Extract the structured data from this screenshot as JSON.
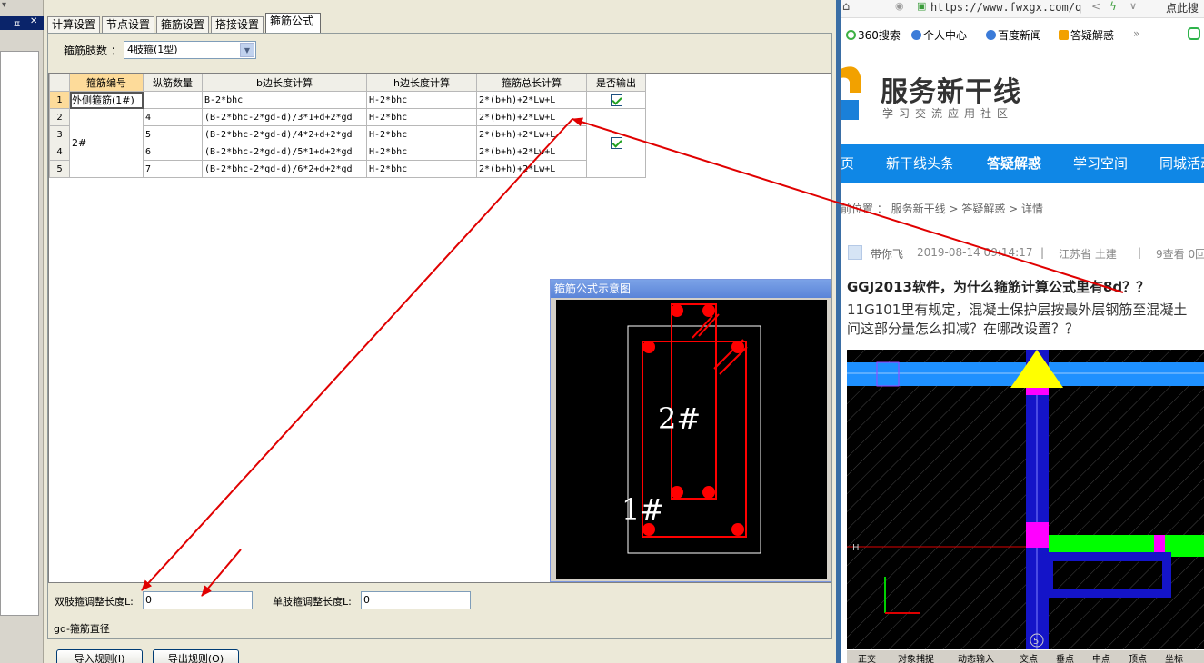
{
  "app": {
    "tabs": [
      "计算设置",
      "节点设置",
      "箍筋设置",
      "搭接设置",
      "箍筋公式"
    ],
    "active_tab": "箍筋公式",
    "limbs_label": "箍筋肢数 ：",
    "limbs_value": "4肢箍(1型)",
    "grid": {
      "headers": [
        "箍筋编号",
        "纵筋数量",
        "b边长度计算",
        "h边长度计算",
        "箍筋总长计算",
        "是否输出"
      ],
      "rows": [
        {
          "num": "1",
          "id": "外侧箍筋(1#)",
          "count": "",
          "b": "B-2*bhc",
          "h": "H-2*bhc",
          "total": "2*(b+h)+2*Lw+L"
        },
        {
          "num": "2",
          "id": "2#",
          "count": "4",
          "b": "(B-2*bhc-2*gd-d)/3*1+d+2*gd",
          "h": "H-2*bhc",
          "total": "2*(b+h)+2*Lw+L"
        },
        {
          "num": "3",
          "id": "",
          "count": "5",
          "b": "(B-2*bhc-2*gd-d)/4*2+d+2*gd",
          "h": "H-2*bhc",
          "total": "2*(b+h)+2*Lw+L"
        },
        {
          "num": "4",
          "id": "",
          "count": "6",
          "b": "(B-2*bhc-2*gd-d)/5*1+d+2*gd",
          "h": "H-2*bhc",
          "total": "2*(b+h)+2*Lw+L"
        },
        {
          "num": "5",
          "id": "",
          "count": "7",
          "b": "(B-2*bhc-2*gd-d)/6*2+d+2*gd",
          "h": "H-2*bhc",
          "total": "2*(b+h)+2*Lw+L"
        }
      ]
    },
    "diagram": {
      "title": "箍筋公式示意图",
      "label_inner": "2#",
      "label_outer": "1#"
    },
    "double_limb_label": "双肢箍调整长度L:",
    "double_limb_value": "0",
    "single_limb_label": "单肢箍调整长度L:",
    "single_limb_value": "0",
    "gd_note": "gd-箍筋直径",
    "import_btn": "导入规则(I)",
    "export_btn": "导出规则(O)",
    "pin_glyph": "ㅍ",
    "close_glyph": "✕"
  },
  "browser": {
    "url": "https://www.fwxgx.com/q",
    "addr_right": "点此搜",
    "bookmarks": [
      "360搜索",
      "个人中心",
      "百度新闻",
      "答疑解惑"
    ],
    "more": "»",
    "logo": "服务新干线",
    "logo_sub": "学习交流应用社区",
    "nav": [
      "页",
      "新干线头条",
      "答疑解惑",
      "学习空间",
      "同城活动"
    ],
    "nav_active": "答疑解惑",
    "breadcrumb": "前位置 ： 服务新干线 > 答疑解惑 > 详情",
    "author": "带你飞",
    "date": "2019-08-14 09:14:17",
    "sep": "|",
    "location": "江苏省  土建",
    "views": "9查看  0回",
    "question_title": "GGJ2013软件，为什么箍筋计算公式里有8d？？",
    "question_body_1": "11G101里有规定，混凝土保护层按最外层钢筋至混凝土",
    "question_body_2": "问这部分量怎么扣减？在哪改设置？？",
    "cad_labels": [
      "H",
      "5"
    ],
    "cad_toolbar": [
      "正交",
      "对象捕捉",
      "动态输入",
      "交点",
      "垂点",
      "中点",
      "顶点",
      "坐标"
    ]
  },
  "colors": {
    "accent_blue": "#0f87e6",
    "arrow_red": "#e00000",
    "grid_selected": "#fddb9a",
    "rebar_red": "#ff0000"
  }
}
